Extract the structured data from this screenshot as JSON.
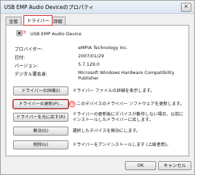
{
  "window": {
    "title": "USB EMP Audio Deviceのプロパティ",
    "close_glyph": "✕"
  },
  "tabs": [
    {
      "label": "全般"
    },
    {
      "label": "ドライバー"
    },
    {
      "label": "詳細"
    }
  ],
  "badges": {
    "tab_marker": "⑦",
    "update_marker": "⑧"
  },
  "device": {
    "name": "USB EMP Audio Device",
    "info": [
      {
        "label": "プロバイダー:",
        "value": "eMPIA Technology Inc."
      },
      {
        "label": "日付:",
        "value": "2007/01/29"
      },
      {
        "label": "バージョン:",
        "value": "5.7.129.0"
      },
      {
        "label": "デジタル署名者:",
        "value": "Microsoft Windows Hardware Compatibility Publisher"
      }
    ]
  },
  "actions": [
    {
      "label": "ドライバーの詳細(I)",
      "desc": "ドライバー ファイルの詳細を表示します。"
    },
    {
      "label": "ドライバーの更新(P)...",
      "desc": "このデバイスのドライバー ソフトウェアを更新します。"
    },
    {
      "label": "ドライバーを元に戻す(R)",
      "desc": "ドライバーの更新後にデバイスが動作しない場合、以前に インストールしたドライバーに戻します。"
    },
    {
      "label": "無効(D)",
      "desc": "選択したデバイスを無効にします。"
    },
    {
      "label": "削除(U)",
      "desc": "ドライバーをアンインストールします (上級者用)。"
    }
  ],
  "footer": {
    "ok_label": "OK",
    "cancel_label": "キャンセル"
  }
}
